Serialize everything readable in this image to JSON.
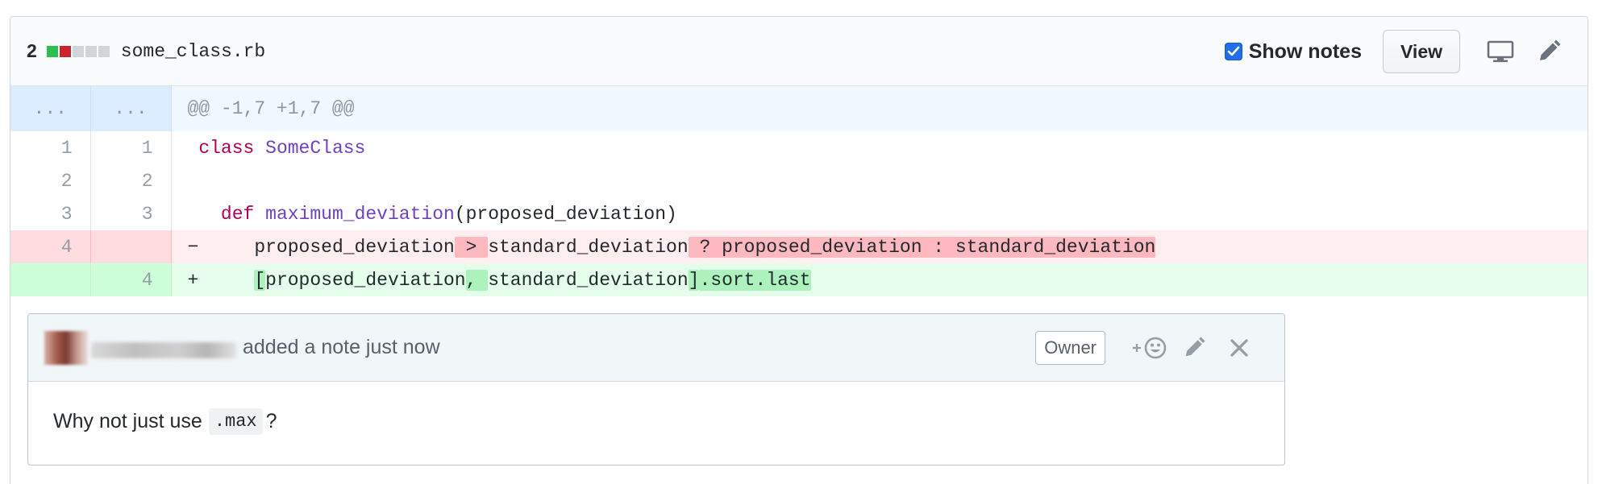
{
  "file": {
    "diffstat_count": "2",
    "diffstat_blocks": [
      "#2cbe4e",
      "#cb2431",
      "#d1d5da",
      "#d1d5da",
      "#d1d5da"
    ],
    "filename": "some_class.rb",
    "show_notes_label": "Show notes",
    "show_notes_checked": true,
    "view_button_label": "View",
    "display_icon": "desktop-icon",
    "edit_icon": "pencil-icon"
  },
  "diff": {
    "hunk": {
      "left_marker": "...",
      "right_marker": "...",
      "header": "@@ -1,7 +1,7 @@"
    },
    "context_lines": [
      {
        "left": "1",
        "right": "1"
      },
      {
        "left": "2",
        "right": "2"
      },
      {
        "left": "3",
        "right": "3"
      }
    ],
    "line1": {
      "kw": "class",
      "name": "SomeClass"
    },
    "line3": {
      "kw": "def",
      "name": "maximum_deviation",
      "args": "(proposed_deviation)"
    },
    "deletion": {
      "left": "4",
      "right": "",
      "sign": "−",
      "parts": [
        "proposed_deviation",
        " > ",
        "standard_deviation",
        " ? proposed_deviation : standard_deviation"
      ]
    },
    "addition": {
      "left": "",
      "right": "4",
      "sign": "+",
      "parts": [
        "[",
        "proposed_deviation",
        ", ",
        "standard_deviation",
        "]",
        ".sort.last"
      ]
    }
  },
  "note": {
    "action_text": "added a note just now",
    "owner_badge": "Owner",
    "reaction_icon": "add-reaction-icon",
    "edit_icon": "pencil-icon",
    "close_icon": "close-icon",
    "body_text": "Why not just use",
    "code": ".max",
    "body_suffix": "?"
  }
}
